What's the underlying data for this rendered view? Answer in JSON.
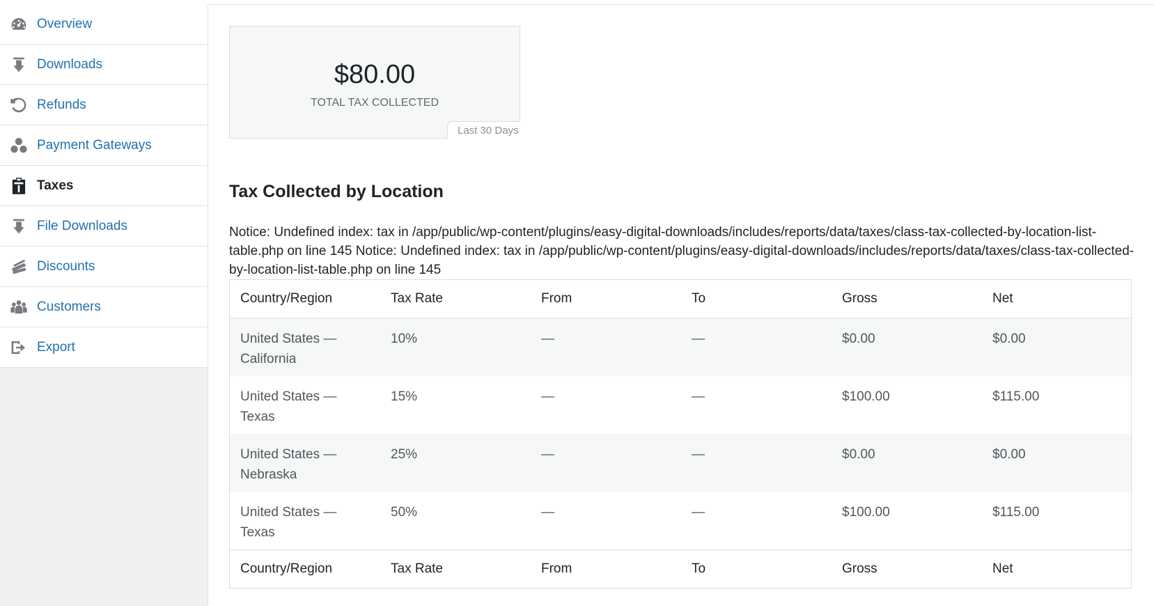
{
  "sidebar": {
    "items": [
      {
        "label": "Overview",
        "icon": "dashboard-icon",
        "active": false
      },
      {
        "label": "Downloads",
        "icon": "download-icon",
        "active": false
      },
      {
        "label": "Refunds",
        "icon": "undo-icon",
        "active": false
      },
      {
        "label": "Payment Gateways",
        "icon": "groups-icon",
        "active": false
      },
      {
        "label": "Taxes",
        "icon": "clipboard-icon",
        "active": true
      },
      {
        "label": "File Downloads",
        "icon": "download-icon",
        "active": false
      },
      {
        "label": "Discounts",
        "icon": "tickets-icon",
        "active": false
      },
      {
        "label": "Customers",
        "icon": "users-icon",
        "active": false
      },
      {
        "label": "Export",
        "icon": "export-icon",
        "active": false
      }
    ]
  },
  "tile": {
    "amount": "$80.00",
    "label": "TOTAL TAX COLLECTED",
    "range": "Last 30 Days"
  },
  "section": {
    "title": "Tax Collected by Location",
    "notice": "Notice: Undefined index: tax in /app/public/wp-content/plugins/easy-digital-downloads/includes/reports/data/taxes/class-tax-collected-by-location-list-table.php on line 145 Notice: Undefined index: tax in /app/public/wp-content/plugins/easy-digital-downloads/includes/reports/data/taxes/class-tax-collected-by-location-list-table.php on line 145"
  },
  "table": {
    "columns": [
      "Country/Region",
      "Tax Rate",
      "From",
      "To",
      "Gross",
      "Net"
    ],
    "rows": [
      {
        "region": "United States — California",
        "rate": "10%",
        "from": "—",
        "to": "—",
        "gross": "$0.00",
        "net": "$0.00"
      },
      {
        "region": "United States — Texas",
        "rate": "15%",
        "from": "—",
        "to": "—",
        "gross": "$100.00",
        "net": "$115.00"
      },
      {
        "region": "United States — Nebraska",
        "rate": "25%",
        "from": "—",
        "to": "—",
        "gross": "$0.00",
        "net": "$0.00"
      },
      {
        "region": "United States — Texas",
        "rate": "50%",
        "from": "—",
        "to": "—",
        "gross": "$100.00",
        "net": "$115.00"
      }
    ]
  },
  "colors": {
    "link": "#2271b1",
    "text": "#1d2327",
    "sidebar_bg": "#f0f0f1",
    "row_alt": "#f6f7f7"
  }
}
